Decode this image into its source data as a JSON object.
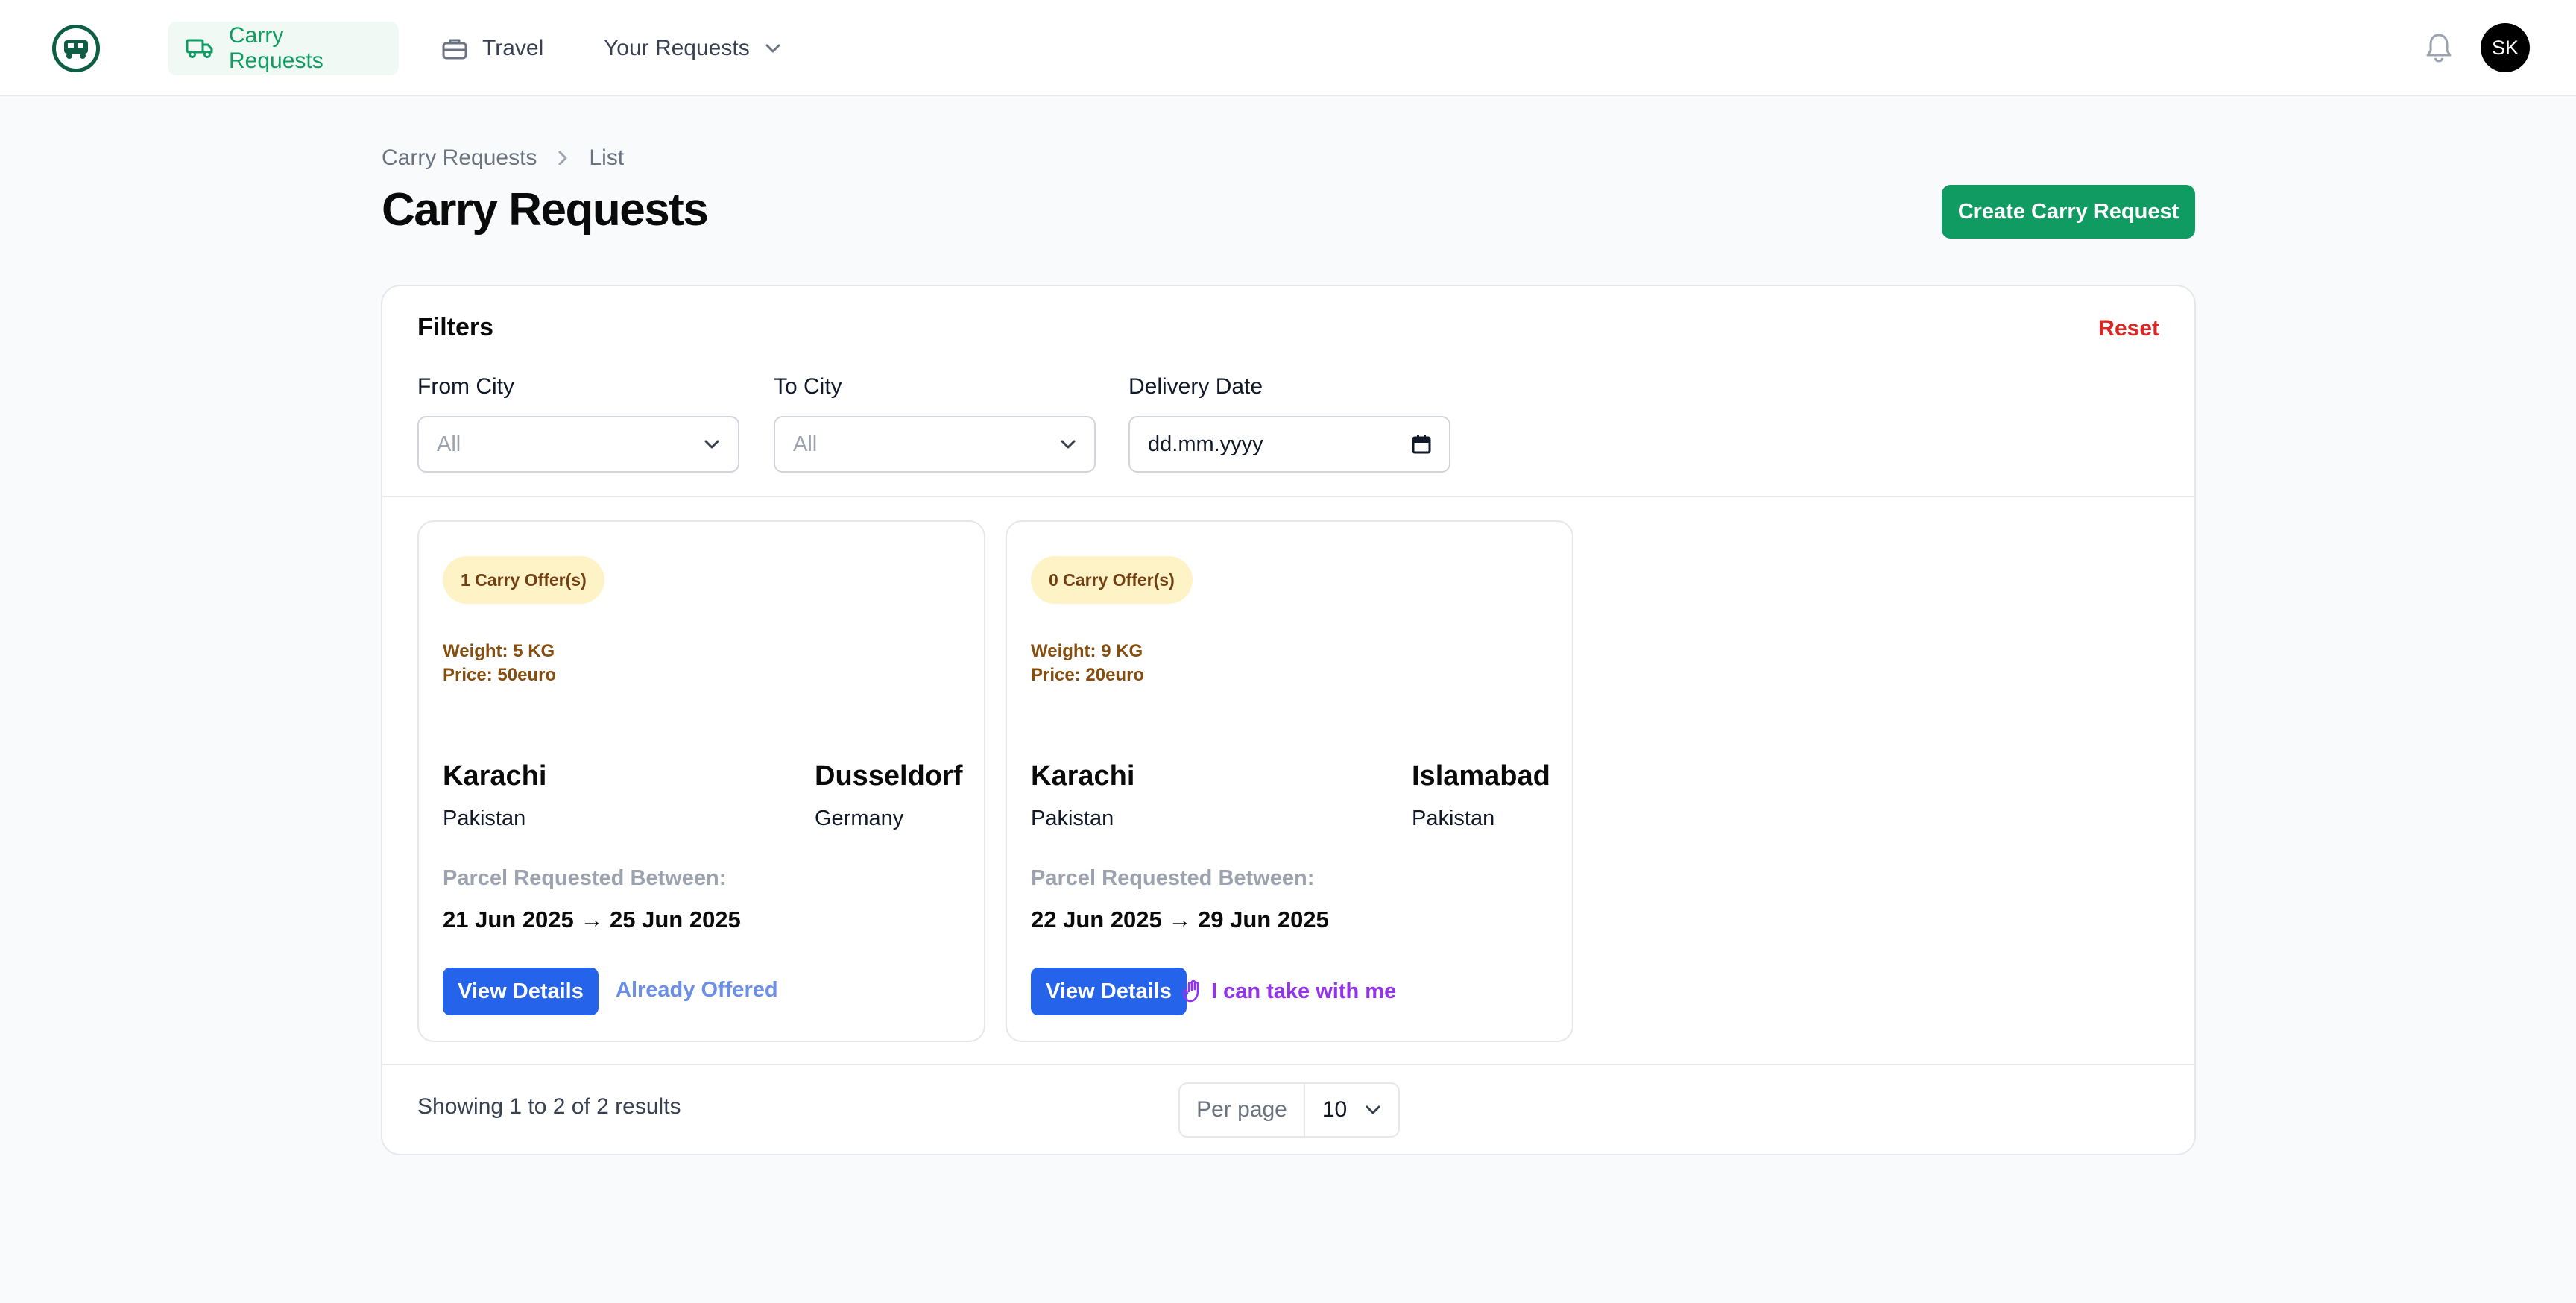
{
  "nav": {
    "items": [
      {
        "label": "Carry Requests",
        "icon": "truck-icon",
        "active": true
      },
      {
        "label": "Travel",
        "icon": "briefcase-icon",
        "active": false
      },
      {
        "label": "Your Requests",
        "icon": "chevron-down-icon",
        "active": false
      }
    ],
    "avatar_initials": "SK"
  },
  "breadcrumb": [
    "Carry Requests",
    "List"
  ],
  "page_title": "Carry Requests",
  "create_button": "Create Carry Request",
  "filters": {
    "title": "Filters",
    "reset": "Reset",
    "from_city": {
      "label": "From City",
      "value": "All"
    },
    "to_city": {
      "label": "To City",
      "value": "All"
    },
    "delivery_date": {
      "label": "Delivery Date",
      "value": "dd.mm.yyyy"
    }
  },
  "cards": [
    {
      "badge": "1 Carry Offer(s)",
      "weight": "Weight: 5 KG",
      "price": "Price: 50euro",
      "from_city": "Karachi",
      "from_country": "Pakistan",
      "to_city": "Dusseldorf",
      "to_country": "Germany",
      "between_label": "Parcel Requested Between:",
      "dates": "21 Jun 2025 → 25 Jun 2025",
      "view_label": "View Details",
      "action_label": "Already Offered"
    },
    {
      "badge": "0 Carry Offer(s)",
      "weight": "Weight: 9 KG",
      "price": "Price: 20euro",
      "from_city": "Karachi",
      "from_country": "Pakistan",
      "to_city": "Islamabad",
      "to_country": "Pakistan",
      "between_label": "Parcel Requested Between:",
      "dates": "22 Jun 2025 → 29 Jun 2025",
      "view_label": "View Details",
      "action_label": "I can take with me"
    }
  ],
  "pagination": {
    "results_text": "Showing 1 to 2 of 2 results",
    "per_page_label": "Per page",
    "per_page_value": "10"
  },
  "colors": {
    "brand_green": "#0f9b61",
    "primary_blue": "#2563eb",
    "danger": "#dc2626",
    "badge_bg": "#fef3c7",
    "accent_purple": "#9333ea"
  }
}
